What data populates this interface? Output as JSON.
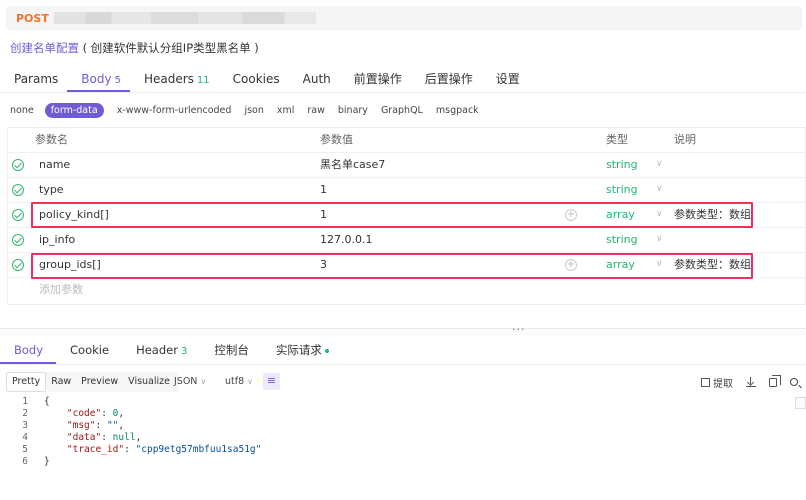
{
  "request": {
    "method": "POST"
  },
  "api": {
    "name": "创建名单配置",
    "description": "( 创建软件默认分组IP类型黑名单 )"
  },
  "tabs": [
    {
      "label": "Params",
      "count": null
    },
    {
      "label": "Body",
      "count": "5"
    },
    {
      "label": "Headers",
      "count": "11"
    },
    {
      "label": "Cookies",
      "count": null
    },
    {
      "label": "Auth",
      "count": null
    },
    {
      "label": "前置操作",
      "count": null
    },
    {
      "label": "后置操作",
      "count": null
    },
    {
      "label": "设置",
      "count": null
    }
  ],
  "body_types": [
    "none",
    "form-data",
    "x-www-form-urlencoded",
    "json",
    "xml",
    "raw",
    "binary",
    "GraphQL",
    "msgpack"
  ],
  "params_table": {
    "headers": {
      "name": "参数名",
      "value": "参数值",
      "type": "类型",
      "desc": "说明"
    },
    "rows": [
      {
        "name": "name",
        "value": "黑名单case7",
        "type": "string",
        "desc": ""
      },
      {
        "name": "type",
        "value": "1",
        "type": "string",
        "desc": ""
      },
      {
        "name": "policy_kind[]",
        "value": "1",
        "type": "array",
        "desc": "参数类型：数组"
      },
      {
        "name": "ip_info",
        "value": "127.0.0.1",
        "type": "string",
        "desc": ""
      },
      {
        "name": "group_ids[]",
        "value": "3",
        "type": "array",
        "desc": "参数类型：数组"
      }
    ],
    "add_placeholder": "添加参数"
  },
  "response_tabs": [
    {
      "label": "Body",
      "count": null
    },
    {
      "label": "Cookie",
      "count": null
    },
    {
      "label": "Header",
      "count": "3"
    },
    {
      "label": "控制台",
      "count": null
    },
    {
      "label": "实际请求",
      "count": null
    }
  ],
  "view_modes": [
    "Pretty",
    "Raw",
    "Preview",
    "Visualize"
  ],
  "format": "JSON",
  "encoding": "utf8",
  "extract_label": "提取",
  "response_code": {
    "line_numbers": [
      "1",
      "2",
      "3",
      "4",
      "5",
      "6"
    ],
    "open_brace": "{",
    "close_brace": "}",
    "fields": [
      {
        "key": "\"code\"",
        "value": "0",
        "kind": "n",
        "comma": ","
      },
      {
        "key": "\"msg\"",
        "value": "\"\"",
        "kind": "s",
        "comma": ","
      },
      {
        "key": "\"data\"",
        "value": "null",
        "kind": "n",
        "comma": ","
      },
      {
        "key": "\"trace_id\"",
        "value": "\"cpp9etg57mbfuu1sa51g\"",
        "kind": "s",
        "comma": ""
      }
    ]
  },
  "colors": {
    "accent": "#6f5cd4",
    "method": "#f4722b",
    "type_text": "#22b573",
    "highlight": "#e8315b"
  }
}
